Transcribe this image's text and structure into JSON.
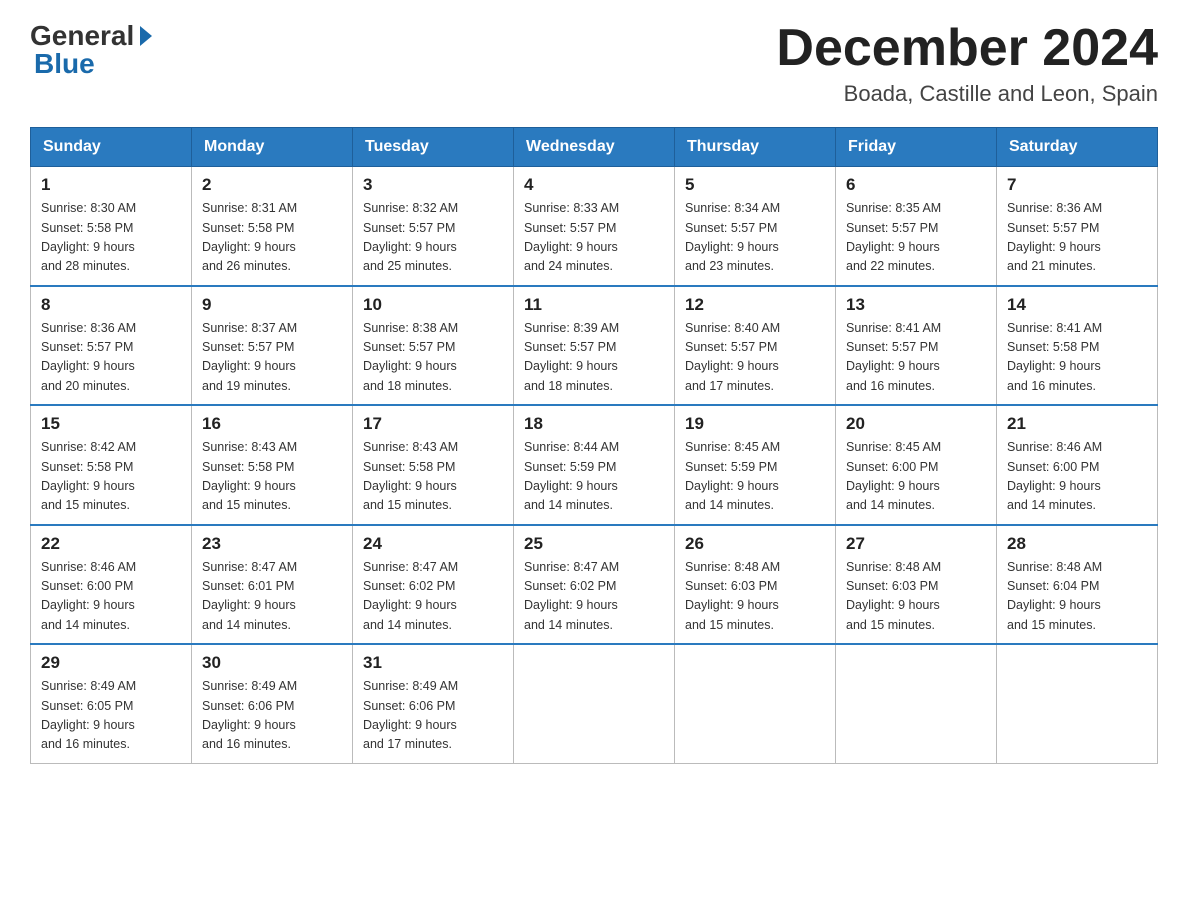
{
  "header": {
    "logo_general": "General",
    "logo_blue": "Blue",
    "title": "December 2024",
    "location": "Boada, Castille and Leon, Spain"
  },
  "weekdays": [
    "Sunday",
    "Monday",
    "Tuesday",
    "Wednesday",
    "Thursday",
    "Friday",
    "Saturday"
  ],
  "weeks": [
    [
      {
        "day": "1",
        "sunrise": "8:30 AM",
        "sunset": "5:58 PM",
        "daylight": "9 hours and 28 minutes."
      },
      {
        "day": "2",
        "sunrise": "8:31 AM",
        "sunset": "5:58 PM",
        "daylight": "9 hours and 26 minutes."
      },
      {
        "day": "3",
        "sunrise": "8:32 AM",
        "sunset": "5:57 PM",
        "daylight": "9 hours and 25 minutes."
      },
      {
        "day": "4",
        "sunrise": "8:33 AM",
        "sunset": "5:57 PM",
        "daylight": "9 hours and 24 minutes."
      },
      {
        "day": "5",
        "sunrise": "8:34 AM",
        "sunset": "5:57 PM",
        "daylight": "9 hours and 23 minutes."
      },
      {
        "day": "6",
        "sunrise": "8:35 AM",
        "sunset": "5:57 PM",
        "daylight": "9 hours and 22 minutes."
      },
      {
        "day": "7",
        "sunrise": "8:36 AM",
        "sunset": "5:57 PM",
        "daylight": "9 hours and 21 minutes."
      }
    ],
    [
      {
        "day": "8",
        "sunrise": "8:36 AM",
        "sunset": "5:57 PM",
        "daylight": "9 hours and 20 minutes."
      },
      {
        "day": "9",
        "sunrise": "8:37 AM",
        "sunset": "5:57 PM",
        "daylight": "9 hours and 19 minutes."
      },
      {
        "day": "10",
        "sunrise": "8:38 AM",
        "sunset": "5:57 PM",
        "daylight": "9 hours and 18 minutes."
      },
      {
        "day": "11",
        "sunrise": "8:39 AM",
        "sunset": "5:57 PM",
        "daylight": "9 hours and 18 minutes."
      },
      {
        "day": "12",
        "sunrise": "8:40 AM",
        "sunset": "5:57 PM",
        "daylight": "9 hours and 17 minutes."
      },
      {
        "day": "13",
        "sunrise": "8:41 AM",
        "sunset": "5:57 PM",
        "daylight": "9 hours and 16 minutes."
      },
      {
        "day": "14",
        "sunrise": "8:41 AM",
        "sunset": "5:58 PM",
        "daylight": "9 hours and 16 minutes."
      }
    ],
    [
      {
        "day": "15",
        "sunrise": "8:42 AM",
        "sunset": "5:58 PM",
        "daylight": "9 hours and 15 minutes."
      },
      {
        "day": "16",
        "sunrise": "8:43 AM",
        "sunset": "5:58 PM",
        "daylight": "9 hours and 15 minutes."
      },
      {
        "day": "17",
        "sunrise": "8:43 AM",
        "sunset": "5:58 PM",
        "daylight": "9 hours and 15 minutes."
      },
      {
        "day": "18",
        "sunrise": "8:44 AM",
        "sunset": "5:59 PM",
        "daylight": "9 hours and 14 minutes."
      },
      {
        "day": "19",
        "sunrise": "8:45 AM",
        "sunset": "5:59 PM",
        "daylight": "9 hours and 14 minutes."
      },
      {
        "day": "20",
        "sunrise": "8:45 AM",
        "sunset": "6:00 PM",
        "daylight": "9 hours and 14 minutes."
      },
      {
        "day": "21",
        "sunrise": "8:46 AM",
        "sunset": "6:00 PM",
        "daylight": "9 hours and 14 minutes."
      }
    ],
    [
      {
        "day": "22",
        "sunrise": "8:46 AM",
        "sunset": "6:00 PM",
        "daylight": "9 hours and 14 minutes."
      },
      {
        "day": "23",
        "sunrise": "8:47 AM",
        "sunset": "6:01 PM",
        "daylight": "9 hours and 14 minutes."
      },
      {
        "day": "24",
        "sunrise": "8:47 AM",
        "sunset": "6:02 PM",
        "daylight": "9 hours and 14 minutes."
      },
      {
        "day": "25",
        "sunrise": "8:47 AM",
        "sunset": "6:02 PM",
        "daylight": "9 hours and 14 minutes."
      },
      {
        "day": "26",
        "sunrise": "8:48 AM",
        "sunset": "6:03 PM",
        "daylight": "9 hours and 15 minutes."
      },
      {
        "day": "27",
        "sunrise": "8:48 AM",
        "sunset": "6:03 PM",
        "daylight": "9 hours and 15 minutes."
      },
      {
        "day": "28",
        "sunrise": "8:48 AM",
        "sunset": "6:04 PM",
        "daylight": "9 hours and 15 minutes."
      }
    ],
    [
      {
        "day": "29",
        "sunrise": "8:49 AM",
        "sunset": "6:05 PM",
        "daylight": "9 hours and 16 minutes."
      },
      {
        "day": "30",
        "sunrise": "8:49 AM",
        "sunset": "6:06 PM",
        "daylight": "9 hours and 16 minutes."
      },
      {
        "day": "31",
        "sunrise": "8:49 AM",
        "sunset": "6:06 PM",
        "daylight": "9 hours and 17 minutes."
      },
      null,
      null,
      null,
      null
    ]
  ],
  "labels": {
    "sunrise_prefix": "Sunrise: ",
    "sunset_prefix": "Sunset: ",
    "daylight_prefix": "Daylight: "
  }
}
